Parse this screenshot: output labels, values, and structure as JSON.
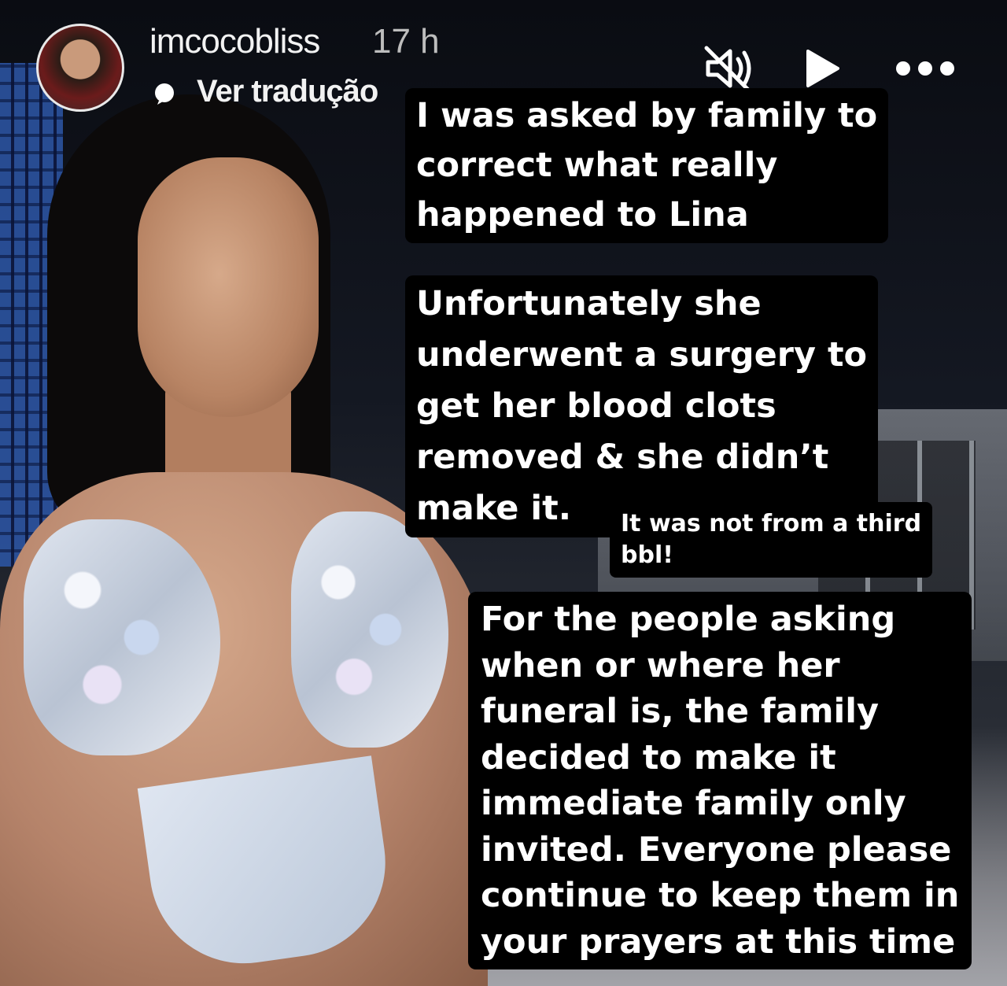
{
  "story": {
    "username": "imcocobliss",
    "timestamp": "17 h",
    "translate_label": "Ver tradução"
  },
  "controls": {
    "mute_icon": "speaker-muted-icon",
    "play_icon": "play-icon",
    "more_icon": "more-options-icon"
  },
  "captions": {
    "block1": [
      "I was asked by family to",
      "correct what really",
      "happened to Lina"
    ],
    "block2": [
      "Unfortunately she",
      "underwent a surgery to",
      "get her blood clots",
      "removed & she didn’t",
      "make it."
    ],
    "block3": [
      "It was not from a third",
      "bbl!"
    ],
    "block4": [
      "For the people asking",
      "when or where her",
      "funeral is, the family",
      "decided to make it",
      "immediate family only",
      "invited. Everyone please",
      "continue to keep them in",
      "your prayers at this time"
    ]
  },
  "colors": {
    "caption_bg": "#000000",
    "caption_text": "#ffffff",
    "header_text": "#f2f2f2",
    "timestamp_text": "#bdbdbd"
  }
}
